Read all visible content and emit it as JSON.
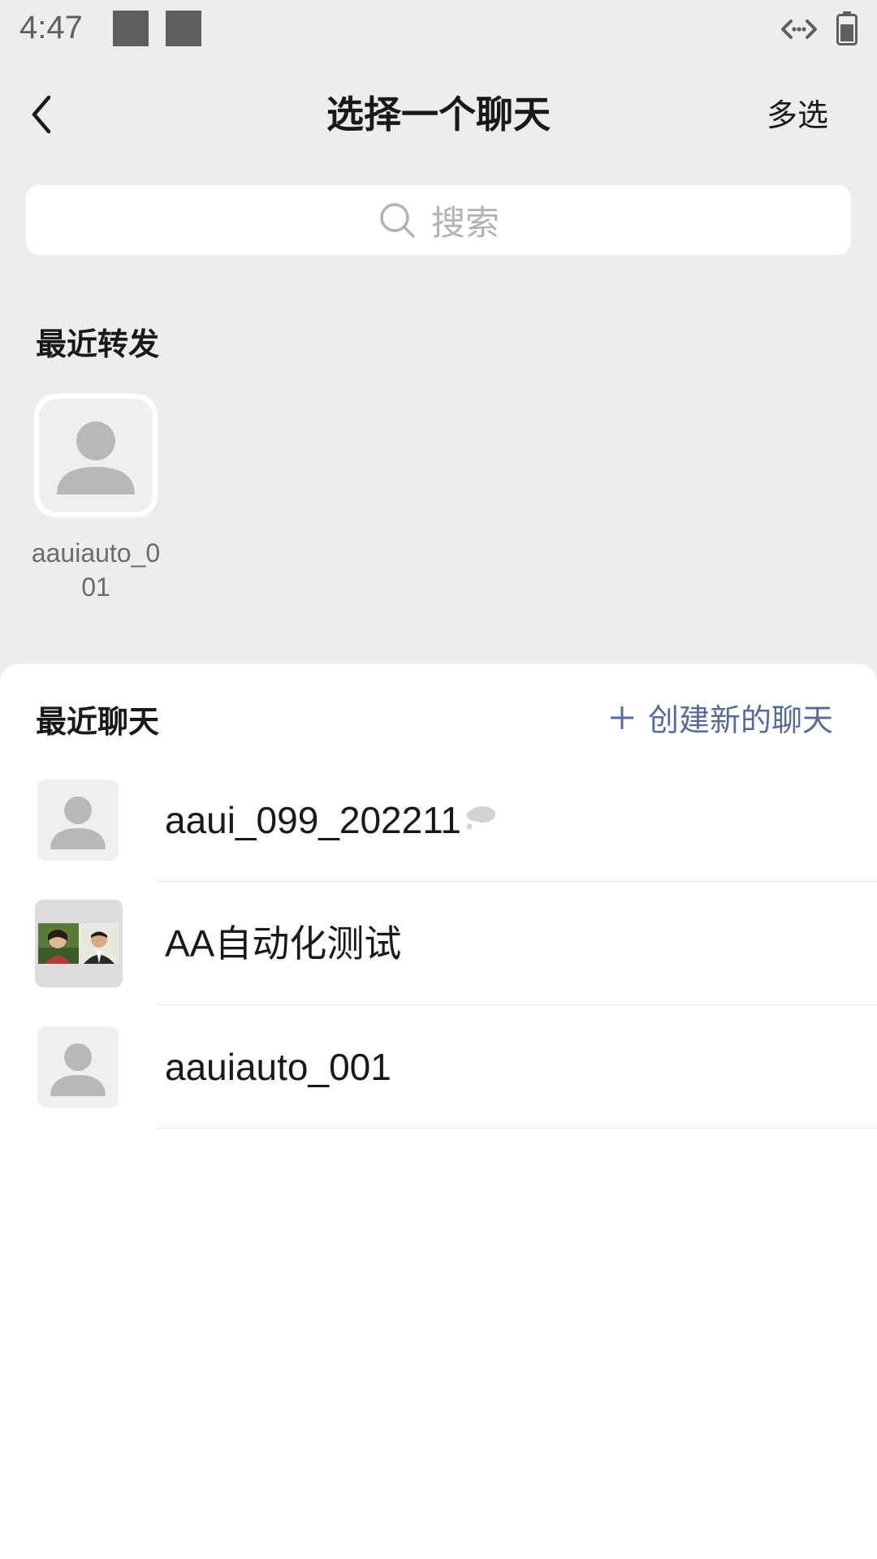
{
  "status_bar": {
    "time": "4:47",
    "icons": [
      "notification-square-icon",
      "notification-square-icon",
      "network-arrows-icon",
      "battery-icon"
    ]
  },
  "header": {
    "back_icon": "chevron-left-icon",
    "title": "选择一个聊天",
    "multi_select_label": "多选"
  },
  "search": {
    "icon": "search-icon",
    "placeholder": "搜索"
  },
  "recent_forward": {
    "title": "最近转发",
    "items": [
      {
        "name": "aauiauto_001",
        "avatar": "default-person-avatar"
      }
    ]
  },
  "recent_chats": {
    "title": "最近聊天",
    "create_label": "创建新的聊天",
    "create_icon": "plus-icon",
    "items": [
      {
        "name": "aaui_099_202211",
        "avatar": "default-person-avatar",
        "muted": true
      },
      {
        "name": "AA自动化测试",
        "avatar": "group-avatar",
        "muted": false
      },
      {
        "name": "aauiauto_001",
        "avatar": "default-person-avatar",
        "muted": false
      }
    ]
  },
  "colors": {
    "page_bg": "#ededed",
    "panel_bg": "#ffffff",
    "link_blue": "#576b95",
    "placeholder_gray": "#b2b2b2",
    "avatar_gray": "#b8b8b8"
  }
}
